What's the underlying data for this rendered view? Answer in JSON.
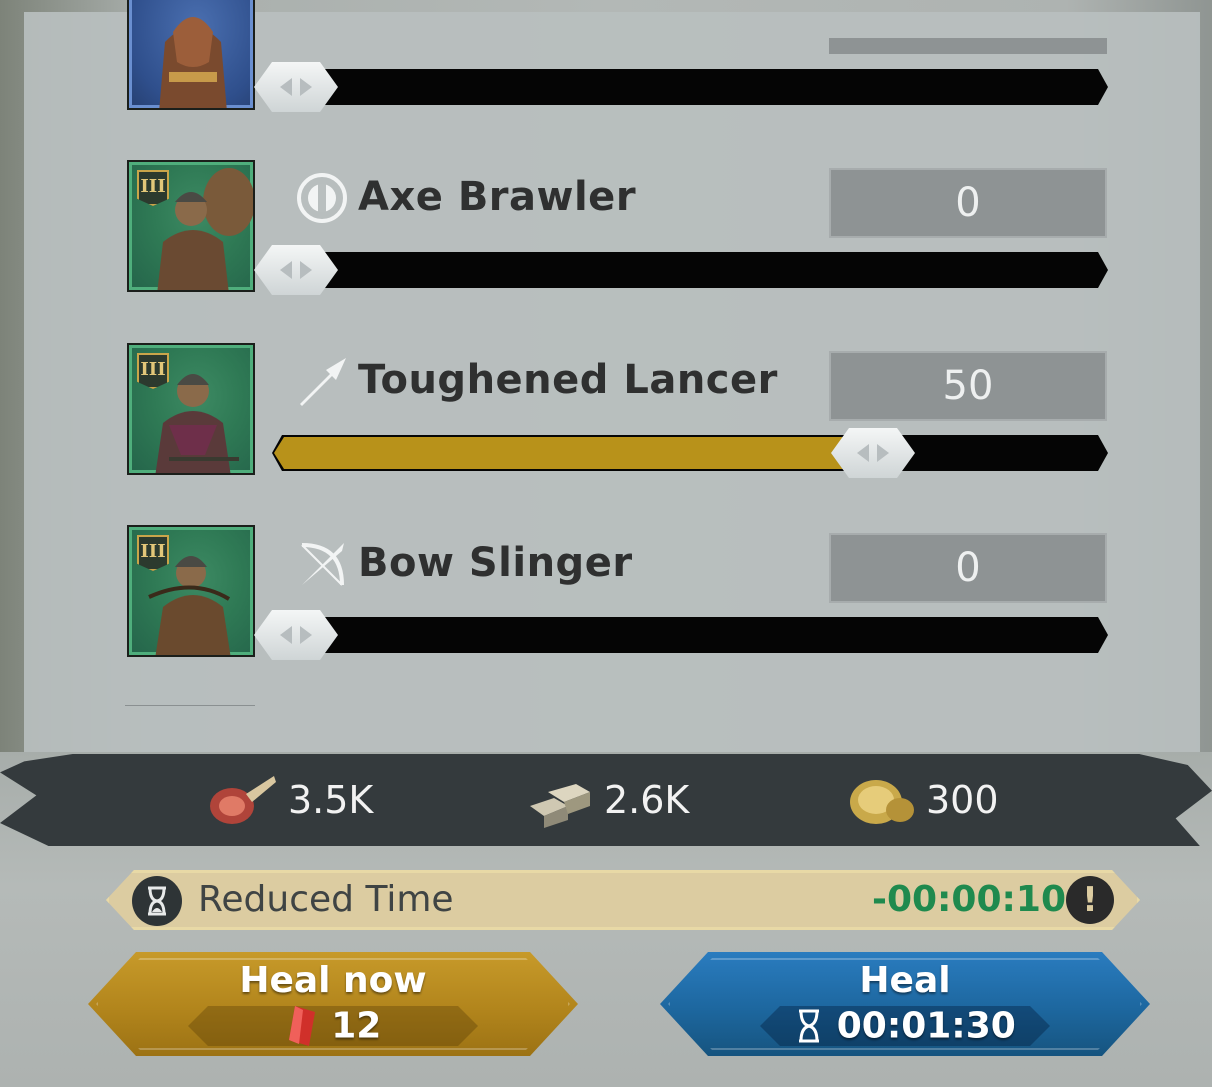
{
  "troops": [
    {
      "name": "",
      "quantity": "",
      "fill_fraction": 0.0
    },
    {
      "name": "Axe Brawler",
      "tier": "III",
      "icon": "shield-icon",
      "quantity": "0",
      "fill_fraction": 0.0
    },
    {
      "name": "Toughened Lancer",
      "tier": "III",
      "icon": "spear-icon",
      "quantity": "50",
      "fill_fraction": 0.72
    },
    {
      "name": "Bow Slinger",
      "tier": "III",
      "icon": "bow-icon",
      "quantity": "0",
      "fill_fraction": 0.0
    }
  ],
  "resources": [
    {
      "icon": "meat-icon",
      "value": "3.5K"
    },
    {
      "icon": "stone-icon",
      "value": "2.6K"
    },
    {
      "icon": "gold-icon",
      "value": "300"
    }
  ],
  "reduced_time": {
    "label": "Reduced Time",
    "value": "-00:00:10",
    "icon": "hourglass-icon",
    "info_icon": "warning-icon"
  },
  "buttons": {
    "heal_now": {
      "label": "Heal now",
      "cost": "12",
      "cost_icon": "gem-icon"
    },
    "heal": {
      "label": "Heal",
      "time": "00:01:30",
      "time_icon": "hourglass-icon"
    }
  },
  "colors": {
    "fill": "#b8921a",
    "heal_now": "#b2851c",
    "heal": "#1d679f",
    "reduced_time_value": "#1f8a4e"
  }
}
